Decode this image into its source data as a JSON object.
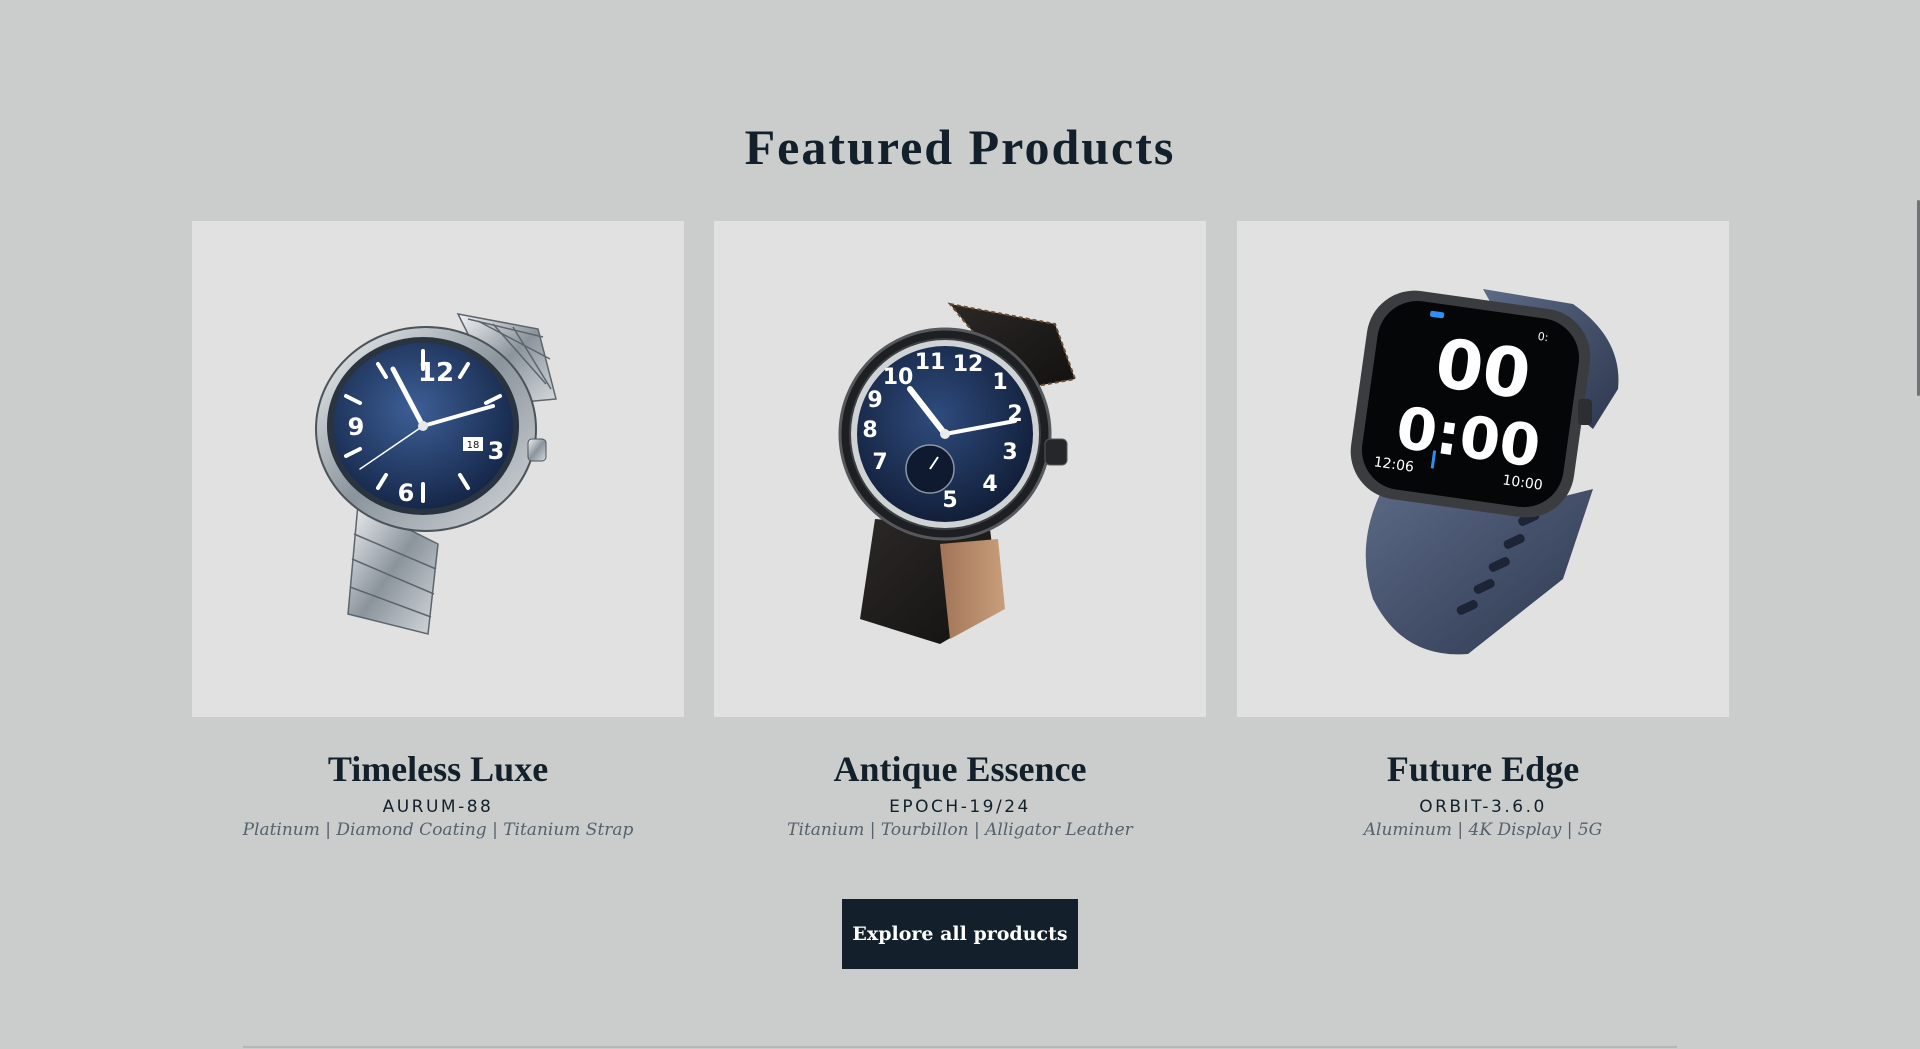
{
  "section": {
    "title": "Featured Products"
  },
  "products": [
    {
      "name": "Timeless Luxe",
      "model": "AURUM-88",
      "specs": "Platinum | Diamond Coating | Titanium Strap",
      "icon": "steel-bracelet-watch-image"
    },
    {
      "name": "Antique Essence",
      "model": "EPOCH-19/24",
      "specs": "Titanium | Tourbillon | Alligator Leather",
      "icon": "leather-strap-watch-image"
    },
    {
      "name": "Future Edge",
      "model": "ORBIT-3.6.0",
      "specs": "Aluminum | 4K Display | 5G",
      "icon": "smartwatch-image"
    }
  ],
  "explore_button": {
    "label": "Explore all products"
  },
  "watch_faces": {
    "luxe": {
      "n12": "12",
      "n9": "9",
      "n3": "3",
      "n6": "6",
      "date": "18"
    },
    "antique": {
      "n10": "10",
      "n11": "11",
      "n12": "12",
      "n1": "1",
      "n2": "2",
      "n3": "3",
      "n4": "4",
      "n5": "5",
      "n7": "7",
      "n8": "8",
      "n9": "9"
    },
    "smart": {
      "big1": "00",
      "big2": "0:00",
      "left": "12:06",
      "right": "10:00",
      "top_right": "0:"
    }
  },
  "colors": {
    "background": "#cacdcc",
    "card_image_bg": "#e0e1e0",
    "text_dark": "#13202b",
    "text_muted": "#55616c",
    "button_bg": "#13202b",
    "dial_blue": "#1e3358"
  }
}
